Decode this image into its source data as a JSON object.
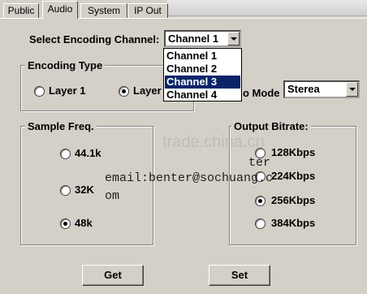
{
  "tabs": [
    {
      "label": "Public"
    },
    {
      "label": "Audio"
    },
    {
      "label": "System"
    },
    {
      "label": "IP Out"
    }
  ],
  "select_channel": {
    "label": "Select Encoding Channel:",
    "value": "Channel 1",
    "options": [
      "Channel 1",
      "Channel 2",
      "Channel 3",
      "Channel 4"
    ],
    "highlighted": "Channel 3"
  },
  "encoding_type": {
    "legend": "Encoding Type",
    "options": [
      "Layer 1",
      "Layer"
    ],
    "selected": "Layer"
  },
  "audio_mode": {
    "label": "o Mode",
    "value": "Sterea"
  },
  "sample_freq": {
    "legend": "Sample Freq.",
    "options": [
      "44.1k",
      "32K",
      "48k"
    ],
    "selected": "48k"
  },
  "output_bitrate": {
    "legend": "Output Bitrate:",
    "options": [
      "128Kbps",
      "224Kbps",
      "256Kbps",
      "384Kbps"
    ],
    "selected": "256Kbps"
  },
  "buttons": {
    "get": "Get",
    "set": "Set"
  },
  "watermark": {
    "site": "trade.china.cn",
    "email_line1": "email:benter@sochuang.c",
    "email_line2": "om",
    "fragment": "ter"
  }
}
